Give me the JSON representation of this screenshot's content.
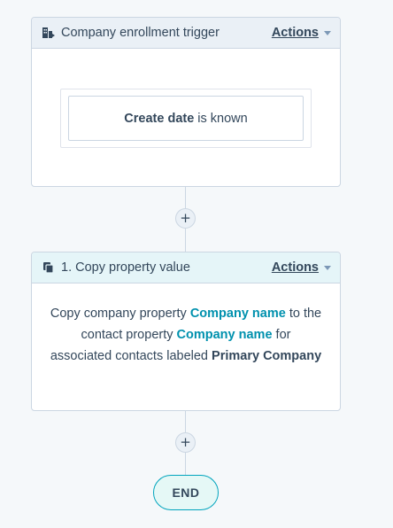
{
  "trigger": {
    "title": "Company enrollment trigger",
    "actions_label": "Actions",
    "icon": "company-trigger-icon",
    "filter": {
      "property": "Create date",
      "condition": "is known"
    }
  },
  "add_button_label": "+",
  "action": {
    "title": "1. Copy property value",
    "actions_label": "Actions",
    "icon": "copy-icon",
    "description": {
      "part1": "Copy company property",
      "source_property": "Company name",
      "part2": "to the contact property",
      "target_property": "Company name",
      "part3": "for associated contacts labeled",
      "label": "Primary Company"
    }
  },
  "end_label": "END",
  "colors": {
    "accent": "#0091ae",
    "border": "#cbd6e2",
    "end_border": "#00a4bd"
  }
}
